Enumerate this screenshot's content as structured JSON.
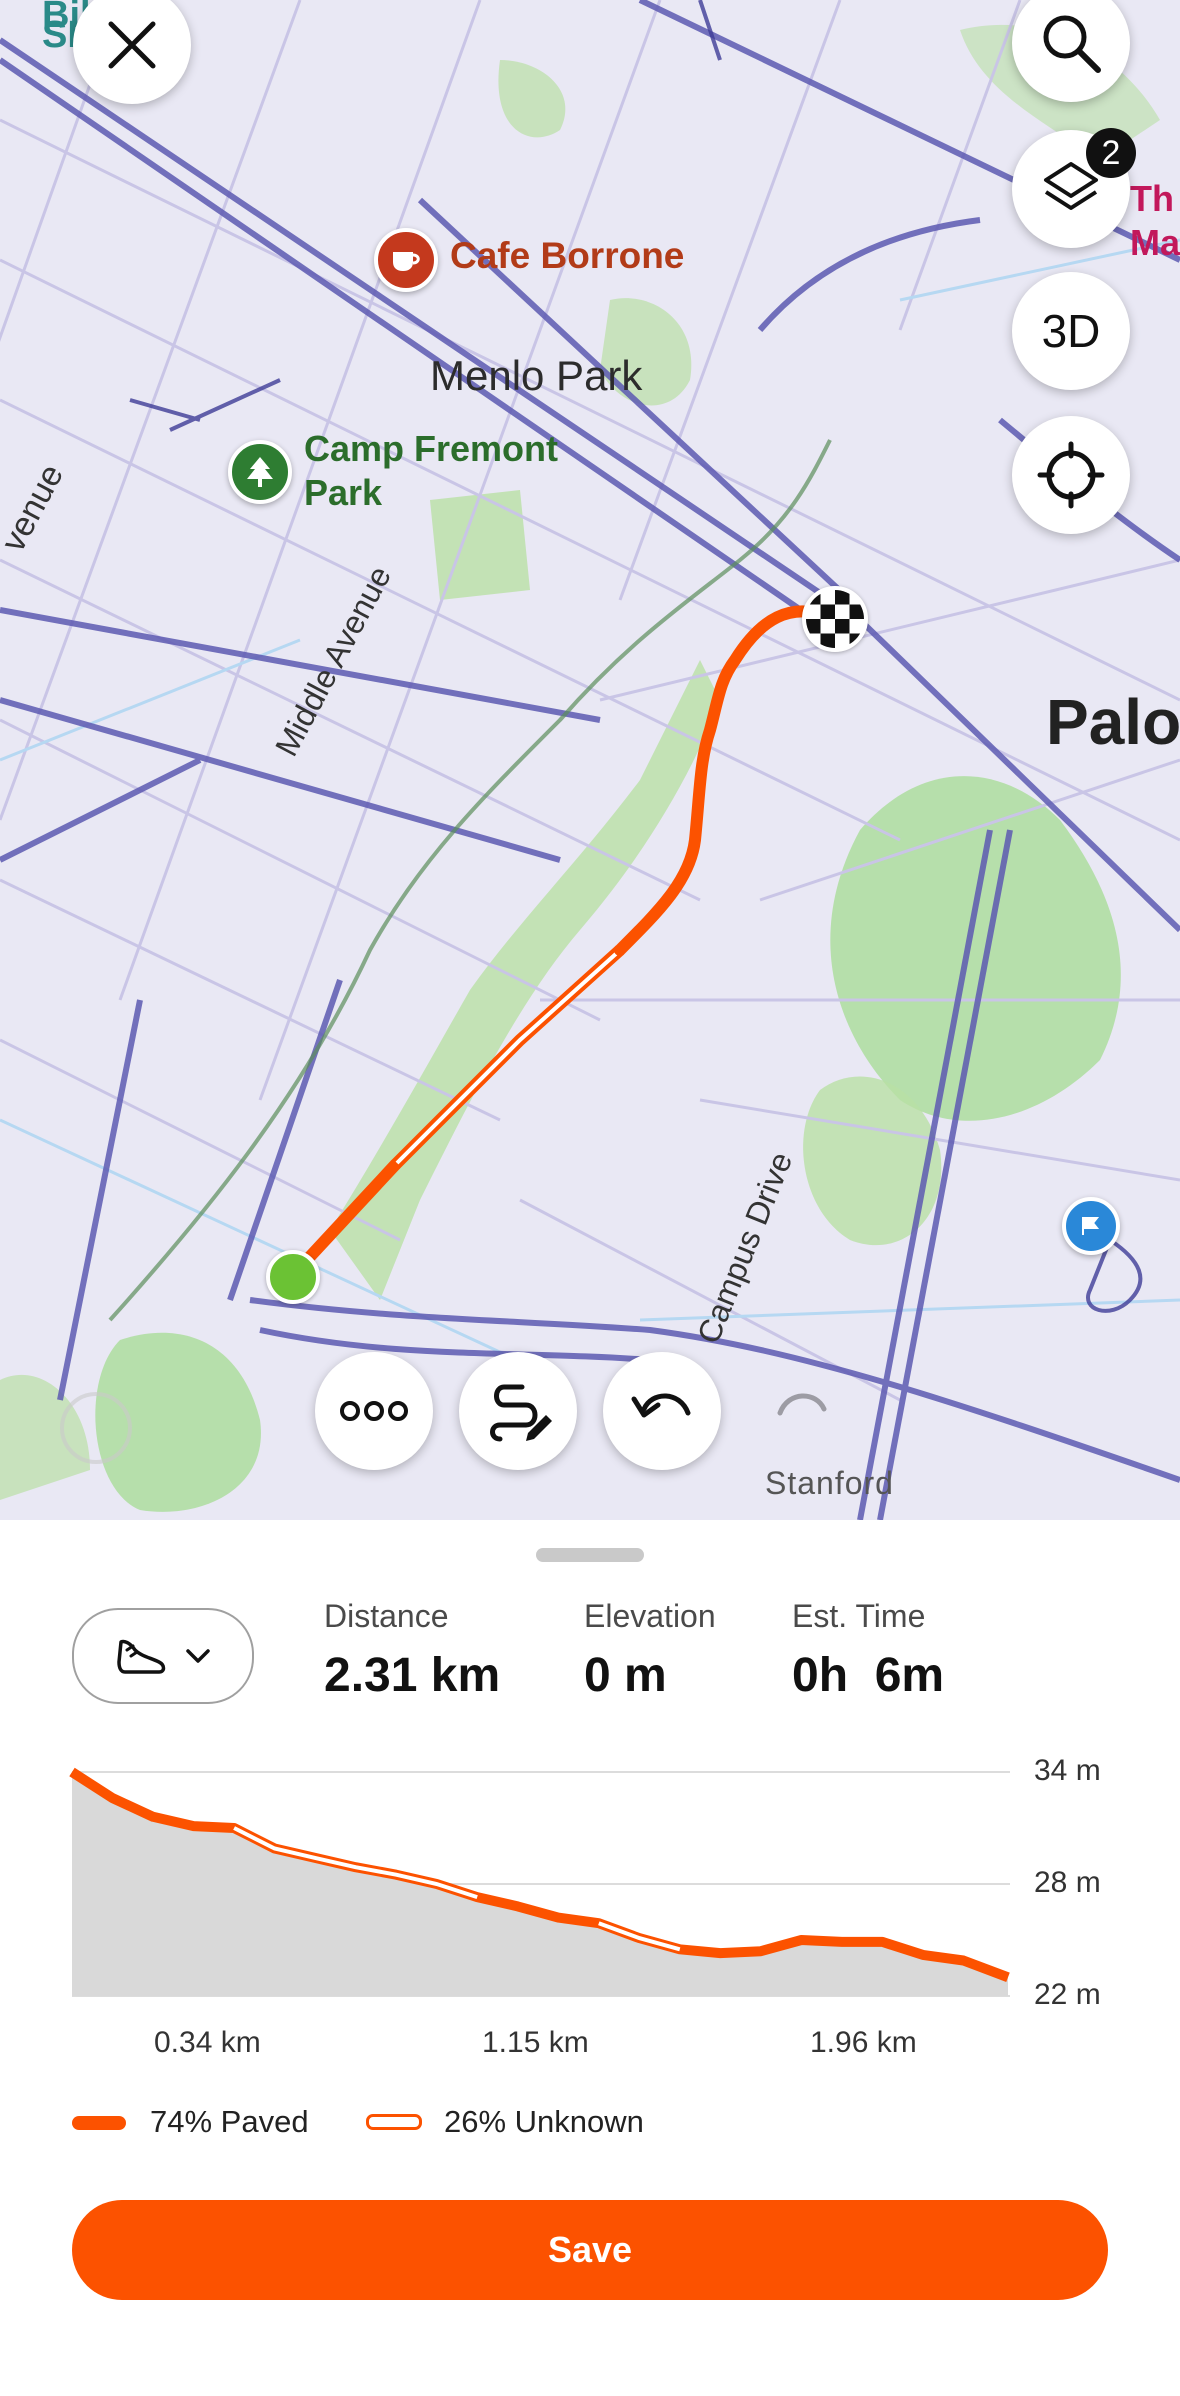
{
  "map": {
    "labels": {
      "cafe": "Cafe Borrone",
      "menlo": "Menlo Park",
      "camp_line1": "Camp Fremont",
      "camp_line2": "Park",
      "middle_ave": "Middle Avenue",
      "campus_drive": "Campus Drive",
      "stanford": "Stanford",
      "palo": "Palo",
      "avenue_frag": "venue",
      "bike_frag": "Bike",
      "sl_frag": "SI",
      "right_frag1": "Th",
      "right_frag2": "Ma"
    },
    "controls": {
      "three_d": "3D",
      "layers_badge": "2"
    }
  },
  "route_stats": {
    "distance_label": "Distance",
    "distance_value": "2.31 km",
    "elevation_label": "Elevation",
    "elevation_value": "0 m",
    "time_label": "Est. Time",
    "time_value": "0h  6m"
  },
  "elevation_chart": {
    "y_ticks": [
      "34 m",
      "28 m",
      "22 m"
    ],
    "x_ticks": [
      "0.34 km",
      "1.15 km",
      "1.96 km"
    ]
  },
  "chart_data": {
    "type": "area",
    "x": [
      0,
      0.1,
      0.2,
      0.3,
      0.4,
      0.5,
      0.6,
      0.7,
      0.8,
      0.9,
      1.0,
      1.1,
      1.2,
      1.3,
      1.4,
      1.5,
      1.6,
      1.7,
      1.8,
      1.9,
      2.0,
      2.1,
      2.2,
      2.31
    ],
    "y": [
      34,
      32.6,
      31.6,
      31.1,
      31.0,
      29.9,
      29.4,
      28.9,
      28.5,
      28.0,
      27.3,
      26.8,
      26.2,
      25.9,
      25.1,
      24.5,
      24.3,
      24.4,
      25.0,
      24.9,
      24.9,
      24.2,
      23.9,
      23.0
    ],
    "ylim": [
      22,
      34
    ],
    "xlim": [
      0,
      2.31
    ],
    "xlabel": "",
    "ylabel": "",
    "surface_colors": {
      "paved": "#fc5200",
      "unknown_outline": "#fc5200",
      "fill": "#d9d9d9"
    }
  },
  "legend": {
    "paved": "74% Paved",
    "unknown": "26% Unknown"
  },
  "save_label": "Save",
  "colors": {
    "accent": "#fc5200",
    "start": "#6bc234"
  }
}
